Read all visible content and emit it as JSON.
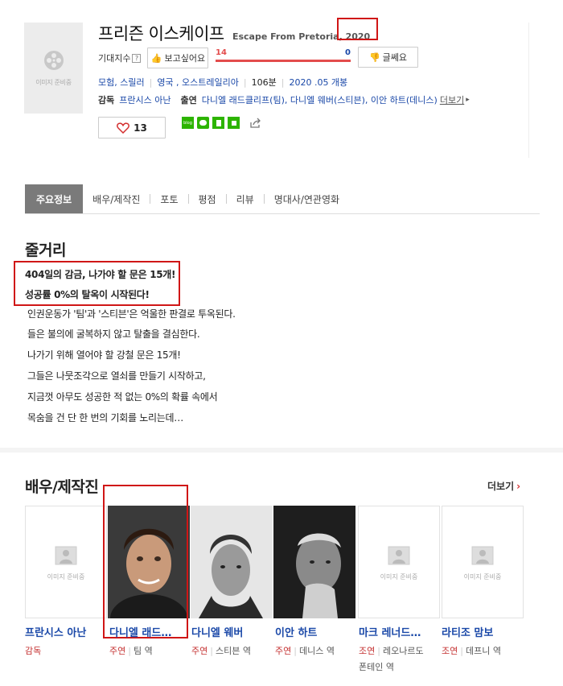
{
  "poster": {
    "placeholder": "이미지 준비중"
  },
  "title": {
    "ko": "프리즌 이스케이프",
    "en": "Escape From Pretoria",
    "year": ", 2020"
  },
  "expectation": {
    "label": "기대지수",
    "help": "?",
    "want_label": "보고싶어요",
    "want_count": "14",
    "dont_count": "0",
    "dont_label": "글쎄요"
  },
  "meta": {
    "genre": "모험, 스릴러",
    "country": "영국 , 오스트레일리아",
    "runtime": "106분",
    "release": "2020 .05 개봉",
    "director_label": "감독",
    "director": "프란시스 아난",
    "cast_label": "출연",
    "cast": "다니엘 래드클리프(팀), 다니엘 웨버(스티븐), 이안 하트(데니스)",
    "more": "더보기"
  },
  "like": {
    "count": "13"
  },
  "share_icons": [
    "blog-icon",
    "talk-icon",
    "bookmark-icon",
    "memo-icon"
  ],
  "tabs": [
    {
      "label": "주요정보",
      "active": true
    },
    {
      "label": "배우/제작진"
    },
    {
      "label": "포토"
    },
    {
      "label": "평점"
    },
    {
      "label": "리뷰"
    },
    {
      "label": "명대사/연관영화"
    }
  ],
  "synopsis": {
    "heading": "줄거리",
    "highlight1": "404일의 감금, 나가야 할 문은 15개!",
    "highlight2": "성공률 0%의 탈옥이 시작된다!",
    "lines": [
      "인권운동가 '팀'과 '스티븐'은 억울한 판결로 투옥된다.",
      "들은 불의에 굴복하지 않고 탈출을 결심한다.",
      "나가기 위해 열어야 할 강철 문은 15개!",
      "그들은 나뭇조각으로 열쇠를 만들기 시작하고,",
      "지금껏 아무도 성공한 적 없는 0%의 확률 속에서",
      "목숨을 건 단 한 번의 기회를 노리는데…"
    ]
  },
  "cast_section": {
    "heading": "배우/제작진",
    "more": "더보기",
    "placeholder": "이미지 준비중",
    "people": [
      {
        "name": "프란시스 아난",
        "role": "감독",
        "character": ""
      },
      {
        "name": "다니엘 래드…",
        "role": "주연",
        "character": "팀 역"
      },
      {
        "name": "다니엘 웨버",
        "role": "주연",
        "character": "스티븐 역"
      },
      {
        "name": "이안 하트",
        "role": "주연",
        "character": "데니스 역"
      },
      {
        "name": "마크 레너드…",
        "role": "조연",
        "character": "레오나르도",
        "character2": "폰테인 역"
      },
      {
        "name": "라티조 맘보",
        "role": "조연",
        "character": "데프니 역"
      }
    ]
  },
  "colors": {
    "accent_red": "#d01616",
    "link_blue": "#1a48a8",
    "bar_red": "#e34c4c"
  }
}
